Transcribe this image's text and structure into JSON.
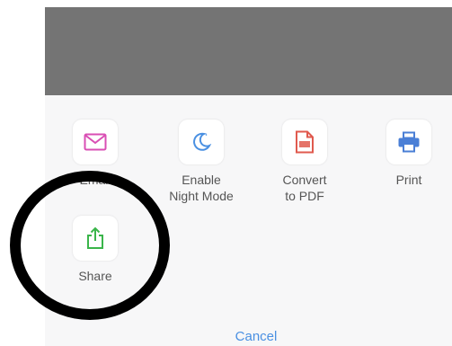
{
  "actions": [
    {
      "label": "Email",
      "icon": "envelope-icon",
      "color": "#d94fb4"
    },
    {
      "label": "Enable\nNight Mode",
      "icon": "moon-icon",
      "color": "#4a90e2"
    },
    {
      "label": "Convert\nto PDF",
      "icon": "pdf-icon",
      "color": "#e05a4e"
    },
    {
      "label": "Print",
      "icon": "printer-icon",
      "color": "#4a7fd6"
    },
    {
      "label": "Share",
      "icon": "share-icon",
      "color": "#3ab54a"
    }
  ],
  "cancel_label": "Cancel",
  "colors": {
    "preview": "#747474",
    "sheet": "#f7f7f8",
    "cancel": "#4a90e2",
    "annotation_circle": "#000000"
  }
}
